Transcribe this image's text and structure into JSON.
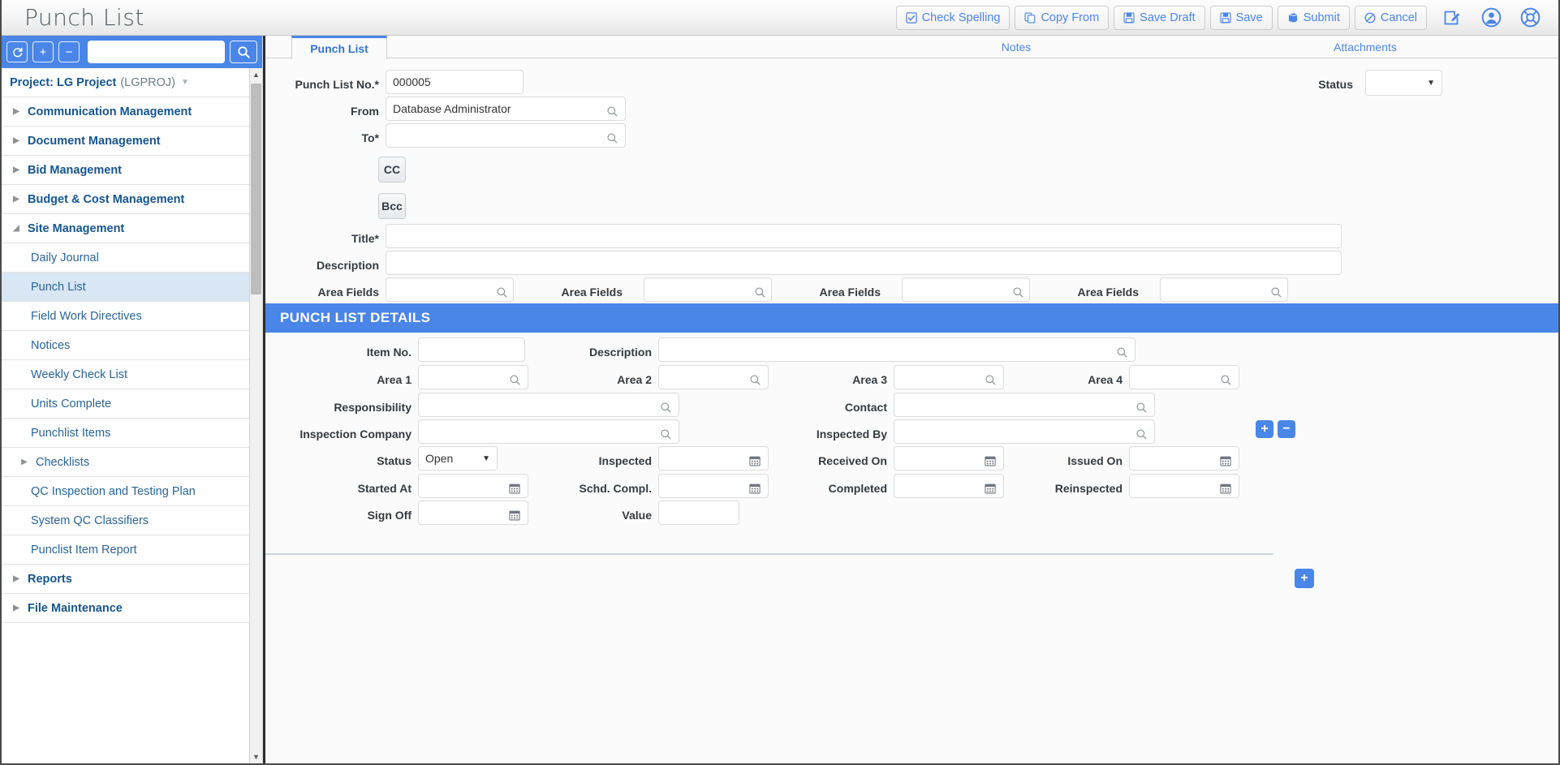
{
  "window": {
    "title": "Punch List"
  },
  "toolbar": {
    "buttons": [
      {
        "label": "Check Spelling",
        "icon": "check-spelling-icon"
      },
      {
        "label": "Copy From",
        "icon": "copy-icon"
      },
      {
        "label": "Save Draft",
        "icon": "save-icon"
      },
      {
        "label": "Save",
        "icon": "save-icon"
      },
      {
        "label": "Submit",
        "icon": "submit-icon"
      },
      {
        "label": "Cancel",
        "icon": "cancel-icon"
      }
    ],
    "icons": [
      {
        "name": "edit-icon"
      },
      {
        "name": "user-icon"
      },
      {
        "name": "help-icon"
      }
    ]
  },
  "sidebar": {
    "search_value": "",
    "search_placeholder": "",
    "refresh_label": "↻",
    "expand_label": "+",
    "collapse_label": "−",
    "project": {
      "label": "Project: LG Project",
      "code": "(LGPROJ)"
    },
    "items": [
      {
        "label": "Communication Management",
        "type": "group",
        "expanded": false
      },
      {
        "label": "Document Management",
        "type": "group",
        "expanded": false
      },
      {
        "label": "Bid Management",
        "type": "group",
        "expanded": false
      },
      {
        "label": "Budget & Cost Management",
        "type": "group",
        "expanded": false
      },
      {
        "label": "Site Management",
        "type": "group",
        "expanded": true
      },
      {
        "label": "Daily Journal",
        "type": "item",
        "active": false
      },
      {
        "label": "Punch List",
        "type": "item",
        "active": true
      },
      {
        "label": "Field Work Directives",
        "type": "item",
        "active": false
      },
      {
        "label": "Notices",
        "type": "item",
        "active": false
      },
      {
        "label": "Weekly Check List",
        "type": "item",
        "active": false
      },
      {
        "label": "Units Complete",
        "type": "item",
        "active": false
      },
      {
        "label": "Punchlist Items",
        "type": "item",
        "active": false
      },
      {
        "label": "Checklists",
        "type": "item-arrow",
        "active": false
      },
      {
        "label": "QC Inspection and Testing Plan",
        "type": "item",
        "active": false
      },
      {
        "label": "System QC Classifiers",
        "type": "item",
        "active": false
      },
      {
        "label": "Punclist Item Report",
        "type": "item",
        "active": false
      },
      {
        "label": "Reports",
        "type": "group",
        "expanded": false
      },
      {
        "label": "File Maintenance",
        "type": "group",
        "expanded": false
      }
    ]
  },
  "main": {
    "tabs": [
      {
        "label": "Punch List",
        "active": true
      },
      {
        "label": "Notes",
        "active": false
      },
      {
        "label": "Attachments",
        "active": false
      }
    ],
    "header_fields": {
      "punch_list_no_label": "Punch List No.",
      "punch_list_no_value": "000005",
      "status_label": "Status",
      "status_value": "",
      "from_label": "From",
      "from_value": "Database Administrator",
      "to_label": "To",
      "to_value": "",
      "cc_label": "CC",
      "bcc_label": "Bcc",
      "title_label": "Title",
      "title_value": "",
      "description_label": "Description",
      "description_value": "",
      "area_fields_label": "Area Fields",
      "area_fields_values": [
        "",
        "",
        "",
        ""
      ]
    },
    "details": {
      "section_title": "PUNCH LIST DETAILS",
      "item_no_label": "Item No.",
      "item_no_value": "",
      "description_label": "Description",
      "description_value": "",
      "area1_label": "Area 1",
      "area1_value": "",
      "area2_label": "Area 2",
      "area2_value": "",
      "area3_label": "Area 3",
      "area3_value": "",
      "area4_label": "Area 4",
      "area4_value": "",
      "responsibility_label": "Responsibility",
      "responsibility_value": "",
      "contact_label": "Contact",
      "contact_value": "",
      "inspection_company_label": "Inspection Company",
      "inspection_company_value": "",
      "inspected_by_label": "Inspected By",
      "inspected_by_value": "",
      "status_label": "Status",
      "status_value": "Open",
      "inspected_label": "Inspected",
      "inspected_value": "",
      "received_on_label": "Received On",
      "received_on_value": "",
      "issued_on_label": "Issued On",
      "issued_on_value": "",
      "started_at_label": "Started At",
      "started_at_value": "",
      "schd_compl_label": "Schd. Compl.",
      "schd_compl_value": "",
      "completed_label": "Completed",
      "completed_value": "",
      "reinspected_label": "Reinspected",
      "reinspected_value": "",
      "sign_off_label": "Sign Off",
      "sign_off_value": "",
      "value_label": "Value",
      "value_value": "",
      "add_row_label": "+",
      "remove_row_label": "−",
      "add_section_label": "+"
    }
  },
  "colors": {
    "accent": "#4a86e8",
    "link": "#2a6496",
    "group": "#15558d",
    "active_row": "#d8e7f3"
  }
}
